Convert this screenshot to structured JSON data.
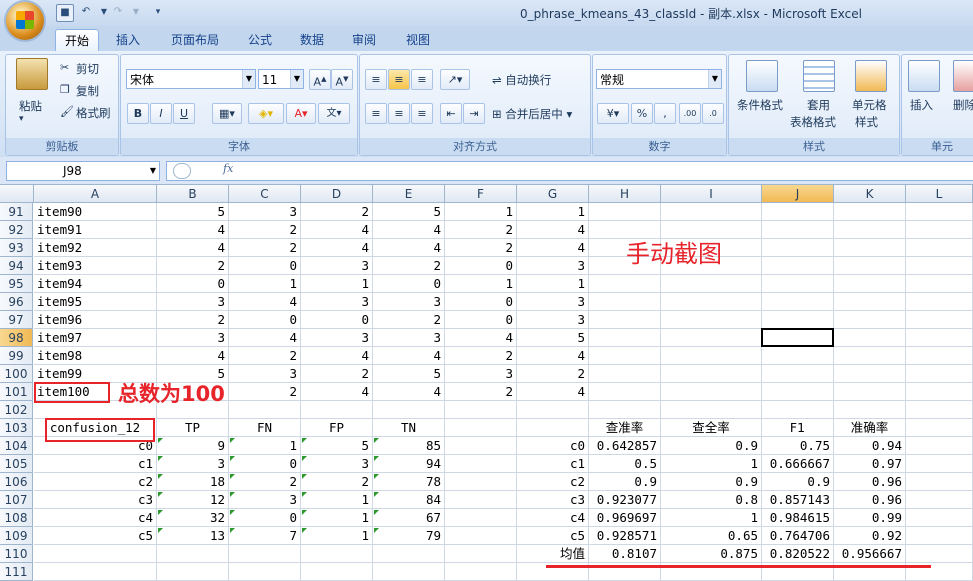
{
  "window": {
    "title": "0_phrase_kmeans_43_classId - 副本.xlsx - Microsoft Excel"
  },
  "tabs": [
    "开始",
    "插入",
    "页面布局",
    "公式",
    "数据",
    "审阅",
    "视图"
  ],
  "ribbon": {
    "clipboard": {
      "paste": "粘贴",
      "cut": "剪切",
      "copy": "复制",
      "format_painter": "格式刷",
      "label": "剪贴板"
    },
    "font": {
      "name": "宋体",
      "size": "11",
      "label": "字体"
    },
    "alignment": {
      "wrap": "自动换行",
      "merge": "合并后居中",
      "label": "对齐方式"
    },
    "number": {
      "format": "常规",
      "label": "数字"
    },
    "styles": {
      "cond": "条件格式",
      "table_1": "套用",
      "table_2": "表格格式",
      "cell_1": "单元格",
      "cell_2": "样式",
      "label": "样式"
    },
    "cells": {
      "insert": "插入",
      "delete": "删除",
      "label": "单元"
    }
  },
  "formula_bar": {
    "name_box": "J98",
    "fx": "fx",
    "content": ""
  },
  "columns": [
    "A",
    "B",
    "C",
    "D",
    "E",
    "F",
    "G",
    "H",
    "I",
    "J",
    "K",
    "L"
  ],
  "selected_cell": {
    "col": "J",
    "row": "98"
  },
  "rows": [
    {
      "n": "91",
      "A": "item90",
      "B": "5",
      "C": "3",
      "D": "2",
      "E": "5",
      "F": "1",
      "G": "1"
    },
    {
      "n": "92",
      "A": "item91",
      "B": "4",
      "C": "2",
      "D": "4",
      "E": "4",
      "F": "2",
      "G": "4"
    },
    {
      "n": "93",
      "A": "item92",
      "B": "4",
      "C": "2",
      "D": "4",
      "E": "4",
      "F": "2",
      "G": "4"
    },
    {
      "n": "94",
      "A": "item93",
      "B": "2",
      "C": "0",
      "D": "3",
      "E": "2",
      "F": "0",
      "G": "3"
    },
    {
      "n": "95",
      "A": "item94",
      "B": "0",
      "C": "1",
      "D": "1",
      "E": "0",
      "F": "1",
      "G": "1"
    },
    {
      "n": "96",
      "A": "item95",
      "B": "3",
      "C": "4",
      "D": "3",
      "E": "3",
      "F": "0",
      "G": "3"
    },
    {
      "n": "97",
      "A": "item96",
      "B": "2",
      "C": "0",
      "D": "0",
      "E": "2",
      "F": "0",
      "G": "3"
    },
    {
      "n": "98",
      "A": "item97",
      "B": "3",
      "C": "4",
      "D": "3",
      "E": "3",
      "F": "4",
      "G": "5"
    },
    {
      "n": "99",
      "A": "item98",
      "B": "4",
      "C": "2",
      "D": "4",
      "E": "4",
      "F": "2",
      "G": "4"
    },
    {
      "n": "100",
      "A": "item99",
      "B": "5",
      "C": "3",
      "D": "2",
      "E": "5",
      "F": "3",
      "G": "2"
    },
    {
      "n": "101",
      "A": "item100",
      "B": "",
      "C": "2",
      "D": "4",
      "E": "4",
      "F": "2",
      "G": "4"
    },
    {
      "n": "102"
    },
    {
      "n": "103",
      "A": "confusion_12",
      "B": "TP",
      "C": "FN",
      "D": "FP",
      "E": "TN",
      "H": "查准率",
      "I": "查全率",
      "J": "F1",
      "K": "准确率"
    },
    {
      "n": "104",
      "A": "c0",
      "B": "9",
      "C": "1",
      "D": "5",
      "E": "85",
      "G": "c0",
      "H": "0.642857",
      "I": "0.9",
      "J": "0.75",
      "K": "0.94"
    },
    {
      "n": "105",
      "A": "c1",
      "B": "3",
      "C": "0",
      "D": "3",
      "E": "94",
      "G": "c1",
      "H": "0.5",
      "I": "1",
      "J": "0.666667",
      "K": "0.97"
    },
    {
      "n": "106",
      "A": "c2",
      "B": "18",
      "C": "2",
      "D": "2",
      "E": "78",
      "G": "c2",
      "H": "0.9",
      "I": "0.9",
      "J": "0.9",
      "K": "0.96"
    },
    {
      "n": "107",
      "A": "c3",
      "B": "12",
      "C": "3",
      "D": "1",
      "E": "84",
      "G": "c3",
      "H": "0.923077",
      "I": "0.8",
      "J": "0.857143",
      "K": "0.96"
    },
    {
      "n": "108",
      "A": "c4",
      "B": "32",
      "C": "0",
      "D": "1",
      "E": "67",
      "G": "c4",
      "H": "0.969697",
      "I": "1",
      "J": "0.984615",
      "K": "0.99"
    },
    {
      "n": "109",
      "A": "c5",
      "B": "13",
      "C": "7",
      "D": "1",
      "E": "79",
      "G": "c5",
      "H": "0.928571",
      "I": "0.65",
      "J": "0.764706",
      "K": "0.92"
    },
    {
      "n": "110",
      "G": "均值",
      "H": "0.8107",
      "I": "0.875",
      "J": "0.820522",
      "K": "0.956667"
    },
    {
      "n": "111"
    }
  ],
  "annotations": {
    "screenshot_note": "手动截图",
    "total_note": "总数为100"
  },
  "colors": {
    "annotation": "#e8242b",
    "selection": "#000000",
    "header_highlight": "#f1b954"
  }
}
